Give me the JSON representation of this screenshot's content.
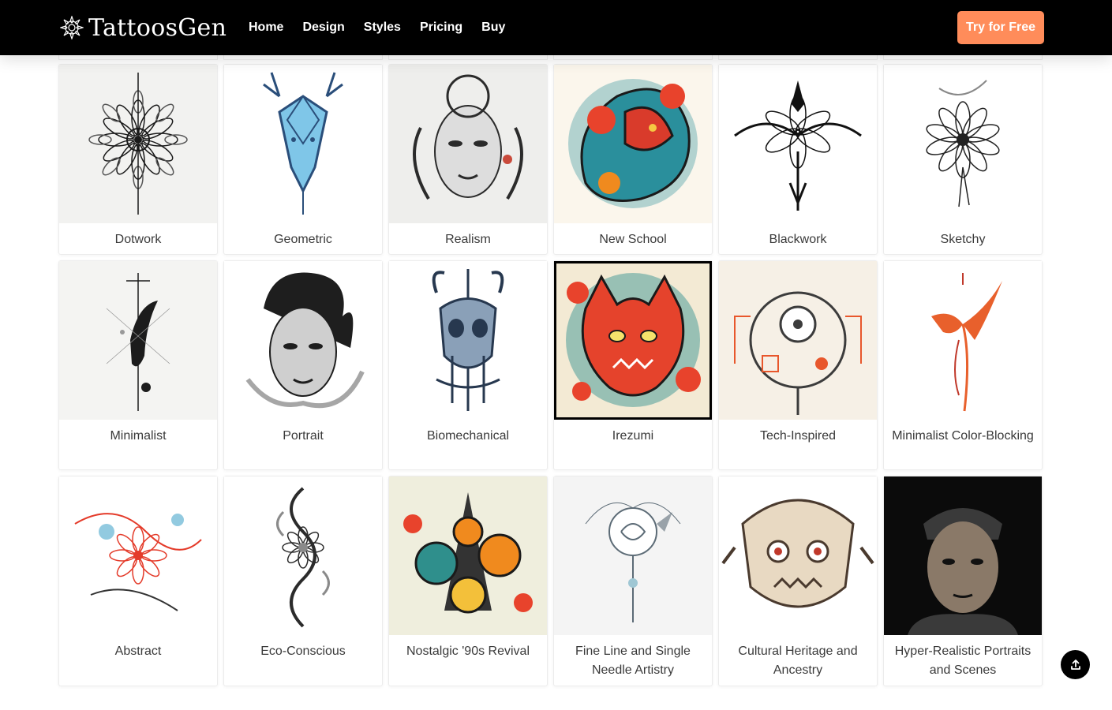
{
  "navbar": {
    "brand": "TattoosGen",
    "links": [
      "Home",
      "Design",
      "Styles",
      "Pricing",
      "Buy"
    ],
    "cta": "Try for Free"
  },
  "gallery": {
    "rows": [
      [
        {
          "label": "Dotwork",
          "palette": [
            "#f2f2f0",
            "#1a1a1a",
            "#555"
          ]
        },
        {
          "label": "Geometric",
          "palette": [
            "#ffffff",
            "#2a4e7a",
            "#7fc6e8"
          ]
        },
        {
          "label": "Realism",
          "palette": [
            "#eeeeec",
            "#2b2b2b",
            "#c94a3b"
          ]
        },
        {
          "label": "New School",
          "palette": [
            "#fbf6ec",
            "#d93b2b",
            "#2a8f9c"
          ]
        },
        {
          "label": "Blackwork",
          "palette": [
            "#ffffff",
            "#111111",
            "#777"
          ]
        },
        {
          "label": "Sketchy",
          "palette": [
            "#ffffff",
            "#222222",
            "#888"
          ]
        }
      ],
      [
        {
          "label": "Minimalist",
          "palette": [
            "#f4f4f2",
            "#1c1c1c",
            "#999"
          ]
        },
        {
          "label": "Portrait",
          "palette": [
            "#ffffff",
            "#1e1e1e",
            "#6b6b6b"
          ]
        },
        {
          "label": "Biomechanical",
          "palette": [
            "#ffffff",
            "#27384f",
            "#8aa0b8"
          ]
        },
        {
          "label": "Irezumi",
          "palette": [
            "#f3ead4",
            "#e5432c",
            "#2b8f8f"
          ]
        },
        {
          "label": "Tech-Inspired",
          "palette": [
            "#f6f0e6",
            "#3c3c3c",
            "#e8572c"
          ]
        },
        {
          "label": "Minimalist Color-Blocking",
          "palette": [
            "#ffffff",
            "#2c8fbf",
            "#e8602c"
          ]
        }
      ],
      [
        {
          "label": "Abstract",
          "palette": [
            "#ffffff",
            "#e43b2a",
            "#4aa6cc"
          ]
        },
        {
          "label": "Eco-Conscious",
          "palette": [
            "#ffffff",
            "#2b2b2b",
            "#8a8a8a"
          ]
        },
        {
          "label": "Nostalgic '90s Revival",
          "palette": [
            "#efeedd",
            "#f08a1e",
            "#2f8f8c"
          ]
        },
        {
          "label": "Fine Line and Single Needle Artistry",
          "palette": [
            "#f4f4f4",
            "#5c6b76",
            "#9fc7d4"
          ]
        },
        {
          "label": "Cultural Heritage and Ancestry",
          "palette": [
            "#ffffff",
            "#4a3a2e",
            "#c0392b"
          ]
        },
        {
          "label": "Hyper-Realistic Portraits and Scenes",
          "palette": [
            "#0b0b0b",
            "#3a3a3a",
            "#8a7968"
          ]
        }
      ]
    ],
    "selected": "Irezumi"
  }
}
